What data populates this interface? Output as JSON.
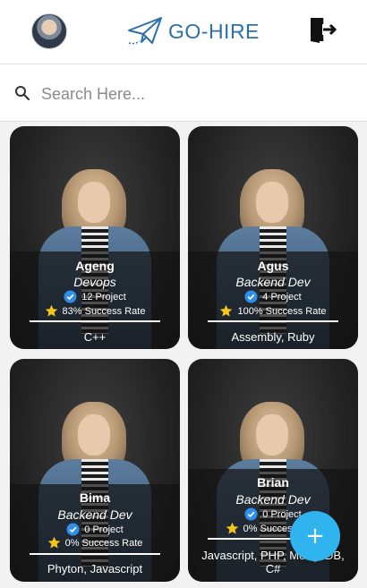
{
  "header": {
    "logo_text": "GO-HIRE",
    "avatar_icon": "user-avatar",
    "logout_icon": "logout-icon"
  },
  "search": {
    "placeholder": "Search Here...",
    "value": ""
  },
  "cards": [
    {
      "name": "Ageng",
      "role": "Devops",
      "projects": "12 Project",
      "success": "83% Success Rate",
      "skills": "C++"
    },
    {
      "name": "Agus",
      "role": "Backend Dev",
      "projects": "4 Project",
      "success": "100% Success Rate",
      "skills": "Assembly, Ruby"
    },
    {
      "name": "Bima",
      "role": "Backend Dev",
      "projects": "0 Project",
      "success": "0% Success Rate",
      "skills": "Phyton, Javascript"
    },
    {
      "name": "Brian",
      "role": "Backend Dev",
      "projects": "0 Project",
      "success": "0% Success Rate",
      "skills": "Javascript, PHP, MongoDB, C#"
    }
  ],
  "fab": {
    "label": "+"
  },
  "colors": {
    "brand": "#2d6fa8",
    "fab": "#2fb4f0",
    "verified": "#2f8fe8",
    "star": "#f5c518"
  }
}
